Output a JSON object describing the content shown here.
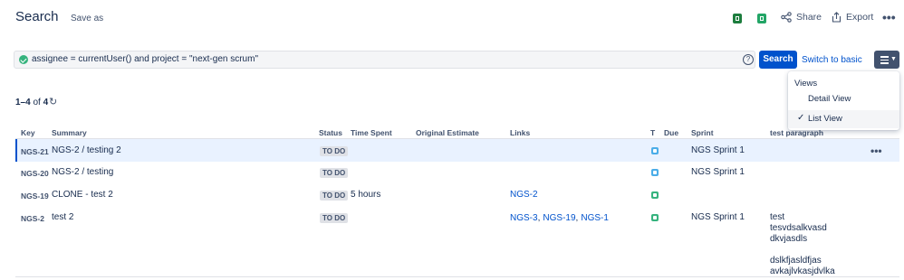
{
  "header": {
    "title": "Search",
    "save_as": "Save as",
    "share_label": "Share",
    "export_label": "Export",
    "more_glyph": "•••"
  },
  "query": {
    "jql": "assignee = currentUser() and project = \"next-gen scrum\"",
    "help_glyph": "?",
    "search_label": "Search",
    "switch_label": "Switch to basic"
  },
  "results": {
    "range": "1–4",
    "of": "of",
    "total": "4"
  },
  "columns": {
    "key": "Key",
    "summary": "Summary",
    "status": "Status",
    "time_spent": "Time Spent",
    "original_estimate": "Original Estimate",
    "links": "Links",
    "type": "T",
    "due": "Due",
    "sprint": "Sprint",
    "test_paragraph": "test paragraph"
  },
  "rows": [
    {
      "key": "NGS-21",
      "summary_parent": "NGS-2",
      "summary_sep": "/",
      "summary": "testing 2",
      "status": "TO DO",
      "time_spent": "",
      "links": [],
      "type": "subtask",
      "sprint": "NGS Sprint 1",
      "test_paragraph": [],
      "row_more": "•••"
    },
    {
      "key": "NGS-20",
      "summary_parent": "NGS-2",
      "summary_sep": "/",
      "summary": "testing",
      "status": "TO DO",
      "time_spent": "",
      "links": [],
      "type": "subtask",
      "sprint": "NGS Sprint 1",
      "test_paragraph": []
    },
    {
      "key": "NGS-19",
      "summary": "CLONE - test 2",
      "status": "TO DO",
      "time_spent": "5 hours",
      "links": [
        "NGS-2"
      ],
      "type": "story",
      "sprint": "",
      "test_paragraph": []
    },
    {
      "key": "NGS-2",
      "summary": "test 2",
      "status": "TO DO",
      "time_spent": "",
      "links": [
        "NGS-3",
        "NGS-19",
        "NGS-1"
      ],
      "link_sep": ",",
      "type": "story",
      "sprint": "NGS Sprint 1",
      "test_paragraph": [
        "test",
        "tesvdsalkvasd",
        "dkvjasdls",
        "",
        "dslkfjasldfjas",
        "avkajlvkasjdvlka"
      ]
    }
  ],
  "views_menu": {
    "heading": "Views",
    "items": [
      {
        "label": "Detail View",
        "selected": false
      },
      {
        "label": "List View",
        "selected": true
      }
    ],
    "check_glyph": "✓"
  },
  "icons": {
    "excel": "excel-export-icon",
    "sheets": "google-sheets-icon",
    "share": "share-icon",
    "export": "export-icon",
    "refresh": "refresh-icon",
    "check": "valid-query-check-icon",
    "view_toggle": "list-view-icon"
  },
  "colors": {
    "primary": "#0052cc",
    "success": "#36b37e",
    "subtask": "#4bade8",
    "story": "#36b37e",
    "highlight": "#e9f2ff"
  }
}
